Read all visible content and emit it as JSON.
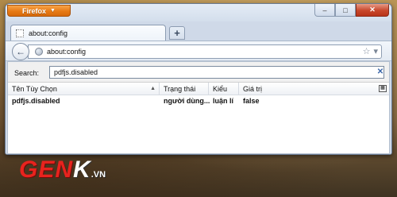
{
  "app": {
    "menu_button_label": "Firefox",
    "menu_caret": "▼"
  },
  "window_controls": {
    "minimize": "–",
    "maximize": "□",
    "close": "✕"
  },
  "tab": {
    "title": "about:config",
    "new_tab_label": "+"
  },
  "nav": {
    "back_glyph": "←",
    "url": "about:config",
    "star_glyph": "☆",
    "dropdown_glyph": "▾"
  },
  "search": {
    "label": "Search:",
    "value": "pdfjs.disabled",
    "clear_glyph": "✕"
  },
  "table": {
    "columns": [
      "Tên Tùy Chọn",
      "Trạng thái",
      "Kiểu",
      "Giá trị"
    ],
    "rows": [
      [
        "pdfjs.disabled",
        "người dùng...",
        "luận lí",
        "false"
      ]
    ]
  },
  "watermark": {
    "brand_main": "GEN",
    "brand_k": "K",
    "brand_suffix": ".VN"
  }
}
